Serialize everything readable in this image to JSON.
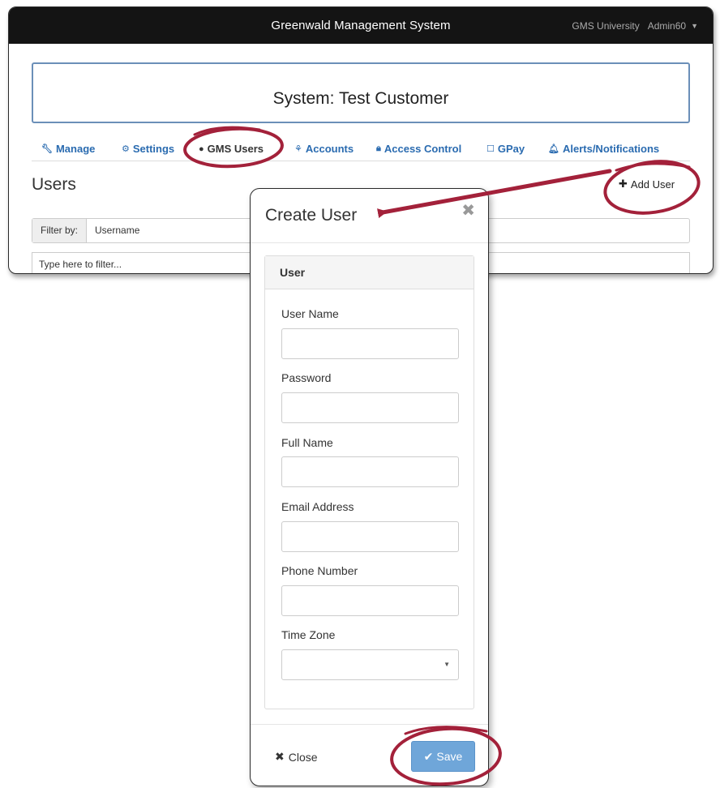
{
  "app": {
    "title": "Greenwald Management System",
    "org": "GMS University",
    "user": "Admin60"
  },
  "system": {
    "title": "System: Test Customer"
  },
  "tabs": [
    {
      "label": "Manage",
      "icon": "wrench-icon"
    },
    {
      "label": "Settings",
      "icon": "gear-icon"
    },
    {
      "label": "GMS Users",
      "icon": "user-icon",
      "active": true
    },
    {
      "label": "Accounts",
      "icon": "sitemap-icon"
    },
    {
      "label": "Access Control",
      "icon": "lock-icon"
    },
    {
      "label": "GPay",
      "icon": "square-icon"
    },
    {
      "label": "Alerts/Notifications",
      "icon": "bell-icon"
    }
  ],
  "users": {
    "heading": "Users",
    "add_label": "Add User",
    "filter_label": "Filter by:",
    "filter_value": "Username",
    "filter_placeholder": "Type here to filter..."
  },
  "modal": {
    "title": "Create User",
    "panel_heading": "User",
    "fields": {
      "username": "User Name",
      "password": "Password",
      "fullname": "Full Name",
      "email": "Email Address",
      "phone": "Phone Number",
      "timezone": "Time Zone"
    },
    "close_label": "Close",
    "save_label": "Save"
  },
  "colors": {
    "topbar": "#141414",
    "link": "#2a6bb0",
    "save_button": "#6fa6d9",
    "annotation": "#a3213a"
  }
}
